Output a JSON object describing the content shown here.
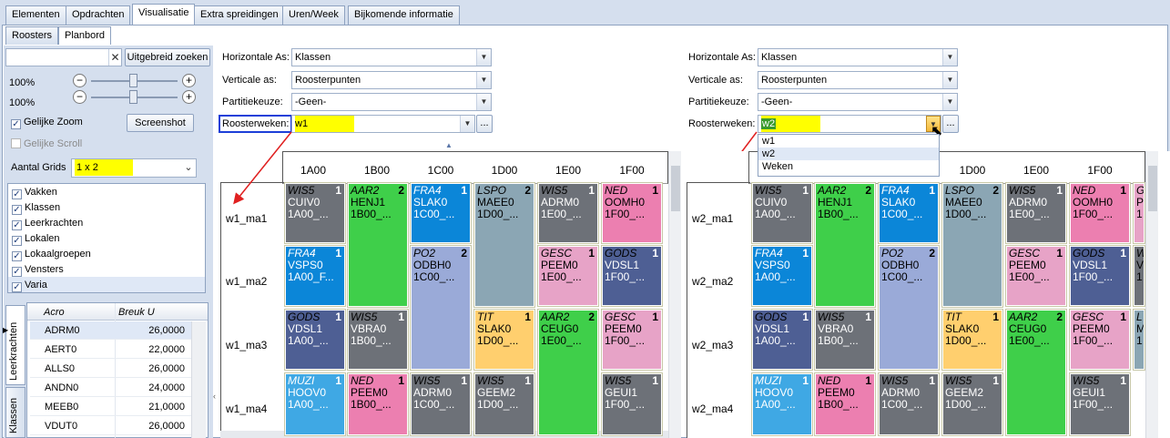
{
  "tabs": [
    "Elementen",
    "Opdrachten",
    "Visualisatie",
    "Extra spreidingen",
    "Uren/Week",
    "Bijkomende informatie"
  ],
  "subtabs": [
    "Roosters",
    "Planbord"
  ],
  "sidebar": {
    "search_value": "",
    "search_button": "Uitgebreid zoeken",
    "zoom1": "100%",
    "zoom2": "100%",
    "gelijke_zoom": "Gelijke Zoom",
    "gelijke_scroll": "Gelijke Scroll",
    "screenshot": "Screenshot",
    "aantal_grids_label": "Aantal Grids",
    "aantal_grids_value": "1 x 2",
    "checks": [
      "Vakken",
      "Klassen",
      "Leerkrachten",
      "Lokalen",
      "Lokaalgroepen",
      "Vensters",
      "Varia"
    ],
    "vtab1": "Leerkrachten",
    "vtab2": "Klassen",
    "table": {
      "col1": "Acro",
      "col2": "Breuk U",
      "rows": [
        [
          "ADRM0",
          "26,0000"
        ],
        [
          "AERT0",
          "22,0000"
        ],
        [
          "ALLS0",
          "26,0000"
        ],
        [
          "ANDN0",
          "24,0000"
        ],
        [
          "MEEB0",
          "21,0000"
        ],
        [
          "VDUT0",
          "26,0000"
        ]
      ]
    }
  },
  "grid1": {
    "h_label": "Horizontale As:",
    "h_value": "Klassen",
    "v_label": "Verticale as:",
    "v_value": "Roosterpunten",
    "p_label": "Partitiekeuze:",
    "p_value": "-Geen-",
    "r_label": "Roosterweken:",
    "r_value": "w1",
    "more": "...",
    "cols": [
      "1A00",
      "1B00",
      "1C00",
      "1D00",
      "1E00",
      "1F00"
    ],
    "rows": [
      "w1_ma1",
      "w1_ma2",
      "w1_ma3",
      "w1_ma4"
    ]
  },
  "grid2": {
    "h_label": "Horizontale As:",
    "h_value": "Klassen",
    "v_label": "Verticale as:",
    "v_value": "Roosterpunten",
    "p_label": "Partitiekeuze:",
    "p_value": "-Geen-",
    "r_label": "Roosterweken:",
    "r_value": "w2",
    "more": "...",
    "dropdown": [
      "w1",
      "w2",
      "Weken"
    ],
    "cols": [
      "1D00",
      "1E00",
      "1F00"
    ],
    "rows": [
      "w2_ma1",
      "w2_ma2",
      "w2_ma3",
      "w2_ma4"
    ]
  },
  "cells1": [
    {
      "t": "WIS5",
      "n": "1",
      "a": "CUIV0",
      "b": "1A00_..."
    },
    {
      "t": "AAR2",
      "n": "2",
      "a": "HENJ1",
      "b": "1B00_..."
    },
    {
      "t": "FRA4",
      "n": "1",
      "a": "SLAK0",
      "b": "1C00_..."
    },
    {
      "t": "LSPO",
      "n": "2",
      "a": "MAEE0",
      "b": "1D00_..."
    },
    {
      "t": "WIS5",
      "n": "1",
      "a": "ADRM0",
      "b": "1E00_..."
    },
    {
      "t": "NED",
      "n": "1",
      "a": "OOMH0",
      "b": "1F00_..."
    },
    {
      "t": "FRA4",
      "n": "1",
      "a": "VSPS0",
      "b": "1A00_F..."
    },
    {
      "t": "PO2",
      "n": "2",
      "a": "ODBH0",
      "b": "1C00_..."
    },
    {
      "t": "GESC",
      "n": "1",
      "a": "PEEM0",
      "b": "1E00_..."
    },
    {
      "t": "GODS",
      "n": "1",
      "a": "VDSL1",
      "b": "1F00_..."
    },
    {
      "t": "GODS",
      "n": "1",
      "a": "VDSL1",
      "b": "1A00_..."
    },
    {
      "t": "WIS5",
      "n": "1",
      "a": "VBRA0",
      "b": "1B00_..."
    },
    {
      "t": "TIT",
      "n": "1",
      "a": "SLAK0",
      "b": "1D00_..."
    },
    {
      "t": "AAR2",
      "n": "2",
      "a": "CEUG0",
      "b": "1E00_..."
    },
    {
      "t": "GESC",
      "n": "1",
      "a": "PEEM0",
      "b": "1F00_..."
    },
    {
      "t": "MUZI",
      "n": "1",
      "a": "HOOV0",
      "b": "1A00_..."
    },
    {
      "t": "NED",
      "n": "1",
      "a": "PEEM0",
      "b": "1B00_..."
    },
    {
      "t": "WIS5",
      "n": "1",
      "a": "ADRM0",
      "b": "1C00_..."
    },
    {
      "t": "WIS5",
      "n": "1",
      "a": "GEEM2",
      "b": "1D00_..."
    },
    {
      "t": "WIS5",
      "n": "1",
      "a": "GEUI1",
      "b": "1F00_..."
    }
  ],
  "cells2": [
    {
      "t": "WIS5",
      "n": "1",
      "a": "CUIV0",
      "b": "1A00_..."
    },
    {
      "t": "AAR2",
      "n": "2",
      "a": "HENJ1",
      "b": "1B00_..."
    },
    {
      "t": "FRA4",
      "n": "1",
      "a": "SLAK0",
      "b": "1C00_..."
    },
    {
      "t": "LSPO",
      "n": "2",
      "a": "MAEE0",
      "b": "1D00_..."
    },
    {
      "t": "WIS5",
      "n": "1",
      "a": "ADRM0",
      "b": "1E00_..."
    },
    {
      "t": "NED",
      "n": "1",
      "a": "OOMH0",
      "b": "1F00_..."
    },
    {
      "t": "G",
      "n": "",
      "a": "P",
      "b": "1"
    },
    {
      "t": "FRA4",
      "n": "1",
      "a": "VSPS0",
      "b": "1A00_..."
    },
    {
      "t": "PO2",
      "n": "2",
      "a": "ODBH0",
      "b": "1C00_..."
    },
    {
      "t": "GESC",
      "n": "1",
      "a": "PEEM0",
      "b": "1E00_..."
    },
    {
      "t": "GODS",
      "n": "1",
      "a": "VDSL1",
      "b": "1F00_..."
    },
    {
      "t": "W",
      "n": "",
      "a": "V",
      "b": "1"
    },
    {
      "t": "GODS",
      "n": "1",
      "a": "VDSL1",
      "b": "1A00_..."
    },
    {
      "t": "WIS5",
      "n": "1",
      "a": "VBRA0",
      "b": "1B00_..."
    },
    {
      "t": "TIT",
      "n": "1",
      "a": "SLAK0",
      "b": "1D00_..."
    },
    {
      "t": "AAR2",
      "n": "2",
      "a": "CEUG0",
      "b": "1E00_..."
    },
    {
      "t": "GESC",
      "n": "1",
      "a": "PEEM0",
      "b": "1F00_..."
    },
    {
      "t": "L",
      "n": "",
      "a": "M",
      "b": "1"
    },
    {
      "t": "MUZI",
      "n": "1",
      "a": "HOOV0",
      "b": "1A00_..."
    },
    {
      "t": "NED",
      "n": "1",
      "a": "PEEM0",
      "b": "1B00_..."
    },
    {
      "t": "WIS5",
      "n": "1",
      "a": "ADRM0",
      "b": "1C00_..."
    },
    {
      "t": "WIS5",
      "n": "1",
      "a": "GEEM2",
      "b": "1D00_..."
    },
    {
      "t": "WIS5",
      "n": "1",
      "a": "GEUI1",
      "b": "1F00_..."
    }
  ],
  "colors": {
    "wis": "#6d7178",
    "aar": "#3fcf4a",
    "fra": "#0b86d8",
    "lspo": "#8ba6b4",
    "ned": "#ec7fb0",
    "po": "#9aaad8",
    "gesc": "#e7a3c7",
    "gods": "#4e5f94",
    "tit": "#ffcf6e",
    "muzi": "#3fa8e4",
    "highlight": "#ffff00",
    "red_arrow": "#e02020"
  }
}
